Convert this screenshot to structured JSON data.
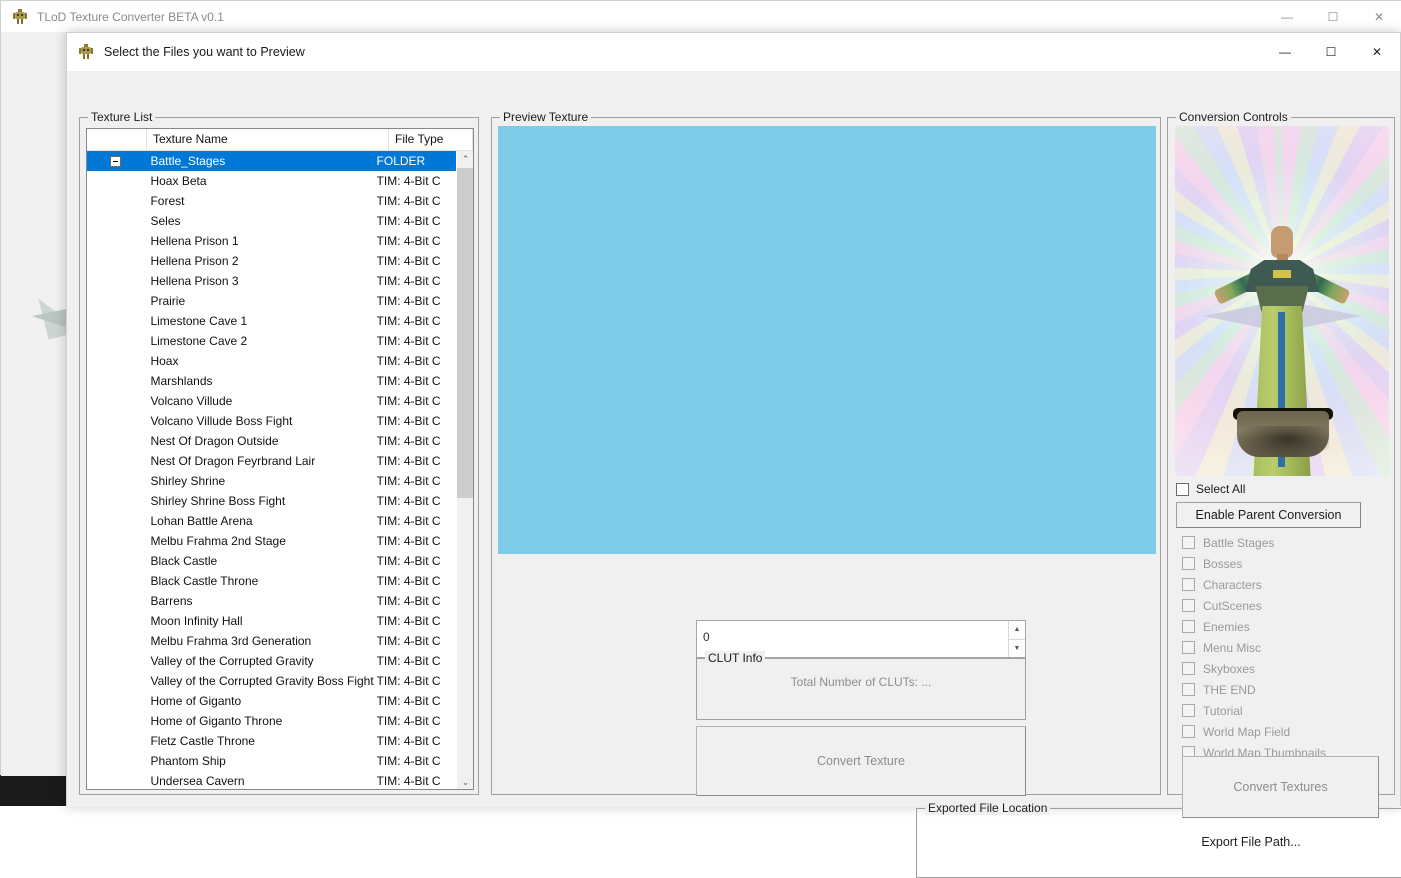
{
  "parent_window": {
    "title": "TLoD Texture Converter BETA v0.1",
    "icon": "app-icon",
    "minimize": "—",
    "maximize": "☐",
    "close": "✕"
  },
  "dialog": {
    "title": "Select the Files you want to Preview",
    "icon": "app-icon",
    "minimize": "—",
    "maximize": "☐",
    "close": "✕"
  },
  "texture_list": {
    "group_title": "Texture List",
    "columns": [
      "",
      "Texture Name",
      "File Type"
    ],
    "scroll_up": "⌃",
    "scroll_down": "⌄",
    "rows": [
      {
        "expander": "minus",
        "name": "Battle_Stages",
        "type": "FOLDER",
        "selected": true
      },
      {
        "expander": "",
        "name": "Hoax Beta",
        "type": "TIM: 4-Bit C",
        "selected": false
      },
      {
        "expander": "",
        "name": "Forest",
        "type": "TIM: 4-Bit C",
        "selected": false
      },
      {
        "expander": "",
        "name": "Seles",
        "type": "TIM: 4-Bit C",
        "selected": false
      },
      {
        "expander": "",
        "name": "Hellena Prison 1",
        "type": "TIM: 4-Bit C",
        "selected": false
      },
      {
        "expander": "",
        "name": "Hellena Prison 2",
        "type": "TIM: 4-Bit C",
        "selected": false
      },
      {
        "expander": "",
        "name": "Hellena Prison 3",
        "type": "TIM: 4-Bit C",
        "selected": false
      },
      {
        "expander": "",
        "name": "Prairie",
        "type": "TIM: 4-Bit C",
        "selected": false
      },
      {
        "expander": "",
        "name": "Limestone Cave 1",
        "type": "TIM: 4-Bit C",
        "selected": false
      },
      {
        "expander": "",
        "name": "Limestone Cave 2",
        "type": "TIM: 4-Bit C",
        "selected": false
      },
      {
        "expander": "",
        "name": "Hoax",
        "type": "TIM: 4-Bit C",
        "selected": false
      },
      {
        "expander": "",
        "name": "Marshlands",
        "type": "TIM: 4-Bit C",
        "selected": false
      },
      {
        "expander": "",
        "name": "Volcano Villude",
        "type": "TIM: 4-Bit C",
        "selected": false
      },
      {
        "expander": "",
        "name": "Volcano Villude Boss Fight",
        "type": "TIM: 4-Bit C",
        "selected": false
      },
      {
        "expander": "",
        "name": "Nest Of Dragon Outside",
        "type": "TIM: 4-Bit C",
        "selected": false
      },
      {
        "expander": "",
        "name": "Nest Of Dragon Feyrbrand Lair",
        "type": "TIM: 4-Bit C",
        "selected": false
      },
      {
        "expander": "",
        "name": "Shirley Shrine",
        "type": "TIM: 4-Bit C",
        "selected": false
      },
      {
        "expander": "",
        "name": "Shirley Shrine Boss Fight",
        "type": "TIM: 4-Bit C",
        "selected": false
      },
      {
        "expander": "",
        "name": "Lohan Battle Arena",
        "type": "TIM: 4-Bit C",
        "selected": false
      },
      {
        "expander": "",
        "name": "Melbu Frahma 2nd Stage",
        "type": "TIM: 4-Bit C",
        "selected": false
      },
      {
        "expander": "",
        "name": "Black Castle",
        "type": "TIM: 4-Bit C",
        "selected": false
      },
      {
        "expander": "",
        "name": "Black Castle Throne",
        "type": "TIM: 4-Bit C",
        "selected": false
      },
      {
        "expander": "",
        "name": "Barrens",
        "type": "TIM: 4-Bit C",
        "selected": false
      },
      {
        "expander": "",
        "name": "Moon Infinity Hall",
        "type": "TIM: 4-Bit C",
        "selected": false
      },
      {
        "expander": "",
        "name": "Melbu Frahma 3rd Generation",
        "type": "TIM: 4-Bit C",
        "selected": false
      },
      {
        "expander": "",
        "name": "Valley of the Corrupted Gravity",
        "type": "TIM: 4-Bit C",
        "selected": false
      },
      {
        "expander": "",
        "name": "Valley of the Corrupted Gravity Boss Fight",
        "type": "TIM: 4-Bit C",
        "selected": false
      },
      {
        "expander": "",
        "name": "Home of Giganto",
        "type": "TIM: 4-Bit C",
        "selected": false
      },
      {
        "expander": "",
        "name": "Home of Giganto Throne",
        "type": "TIM: 4-Bit C",
        "selected": false
      },
      {
        "expander": "",
        "name": "Fletz Castle Throne",
        "type": "TIM: 4-Bit C",
        "selected": false
      },
      {
        "expander": "",
        "name": "Phantom Ship",
        "type": "TIM: 4-Bit C",
        "selected": false
      },
      {
        "expander": "",
        "name": "Undersea Cavern",
        "type": "TIM: 4-Bit C",
        "selected": false
      }
    ]
  },
  "preview": {
    "group_title": "Preview Texture",
    "canvas_color": "#7fcce8",
    "clut_index_value": "0",
    "spin_up": "▲",
    "spin_down": "▼",
    "clut_info_title": "CLUT Info",
    "clut_info_text": "Total Number of CLUTs: ...",
    "convert_texture_label": "Convert Texture",
    "exported_group_title": "Exported File Location",
    "export_path_label": "Export File Path..."
  },
  "conversion": {
    "group_title": "Conversion Controls",
    "select_all_label": "Select All",
    "enable_parent_label": "Enable Parent Conversion",
    "folders": [
      "Battle Stages",
      "Bosses",
      "Characters",
      "CutScenes",
      "Enemies",
      "Menu Misc",
      "Skyboxes",
      "THE END",
      "Tutorial",
      "World Map Field",
      "World Map Thumbnails"
    ],
    "convert_textures_label": "Convert Textures"
  },
  "colors": {
    "selection_blue": "#0078d7",
    "preview_blue": "#7fcce8",
    "window_gray": "#f0f0f0"
  }
}
